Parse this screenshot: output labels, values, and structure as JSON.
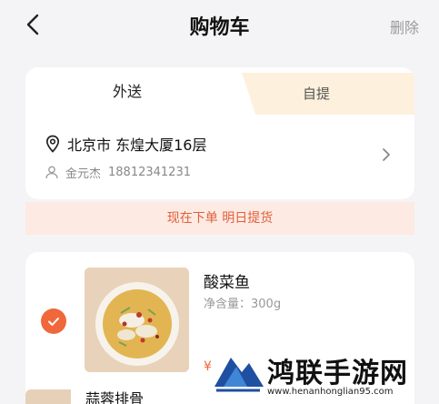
{
  "header": {
    "title": "购物车",
    "delete_label": "删除"
  },
  "delivery": {
    "tabs": [
      {
        "label": "外送",
        "active": true
      },
      {
        "label": "自提",
        "active": false
      }
    ],
    "address": "北京市 东煌大厦16层",
    "contact_name": "金元杰",
    "contact_phone": "18812341231"
  },
  "notice": "现在下单 明日提货",
  "cart": {
    "items": [
      {
        "name": "酸菜鱼",
        "weight": "净含量：300g",
        "price_symbol": "¥",
        "checked": true
      },
      {
        "name": "蒜蓉排骨"
      }
    ]
  },
  "watermark": {
    "brand": "鸿联手游网",
    "url": "www.henanhonglian95.com"
  },
  "colors": {
    "accent": "#f0673b",
    "notice_bg": "#fdeae3",
    "inactive_tab": "#fdf0dc",
    "background": "#f4f4f6"
  }
}
